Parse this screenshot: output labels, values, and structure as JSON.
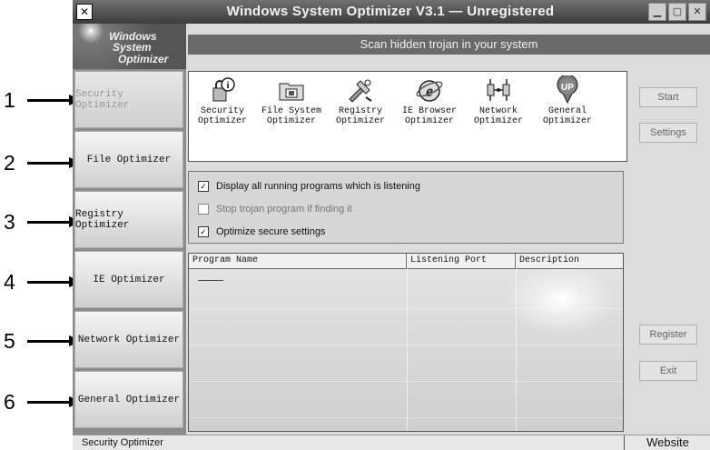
{
  "window": {
    "title": "Windows System Optimizer V3.1 — Unregistered",
    "logo": {
      "line1": "Windows",
      "line2": "System",
      "line3": "Optimizer"
    },
    "header_text": "Scan hidden trojan in your system"
  },
  "callouts": [
    "1",
    "2",
    "3",
    "4",
    "5",
    "6"
  ],
  "sidebar": {
    "items": [
      {
        "label": "Security Optimizer",
        "active": true
      },
      {
        "label": "File Optimizer"
      },
      {
        "label": "Registry Optimizer"
      },
      {
        "label": "IE Optimizer"
      },
      {
        "label": "Network Optimizer"
      },
      {
        "label": "General Optimizer"
      }
    ]
  },
  "tools": [
    {
      "line1": "Security",
      "line2": "Optimizer",
      "icon": "security-icon"
    },
    {
      "line1": "File System",
      "line2": "Optimizer",
      "icon": "folder-icon"
    },
    {
      "line1": "Registry",
      "line2": "Optimizer",
      "icon": "registry-icon"
    },
    {
      "line1": "IE Browser",
      "line2": "Optimizer",
      "icon": "ie-icon"
    },
    {
      "line1": "Network",
      "line2": "Optimizer",
      "icon": "network-icon"
    },
    {
      "line1": "General",
      "line2": "Optimizer",
      "icon": "up-icon"
    }
  ],
  "right_buttons": {
    "start": "Start",
    "settings": "Settings",
    "register": "Register",
    "exit": "Exit"
  },
  "options": [
    {
      "label": "Display all running programs which is listening",
      "checked": true,
      "enabled": true
    },
    {
      "label": "Stop trojan program if finding it",
      "checked": false,
      "enabled": false
    },
    {
      "label": "Optimize secure settings",
      "checked": true,
      "enabled": true
    }
  ],
  "listview": {
    "columns": [
      "Program Name",
      "Listening Port",
      "Description"
    ]
  },
  "statusbar": {
    "left": "Security Optimizer",
    "right": "Website"
  }
}
